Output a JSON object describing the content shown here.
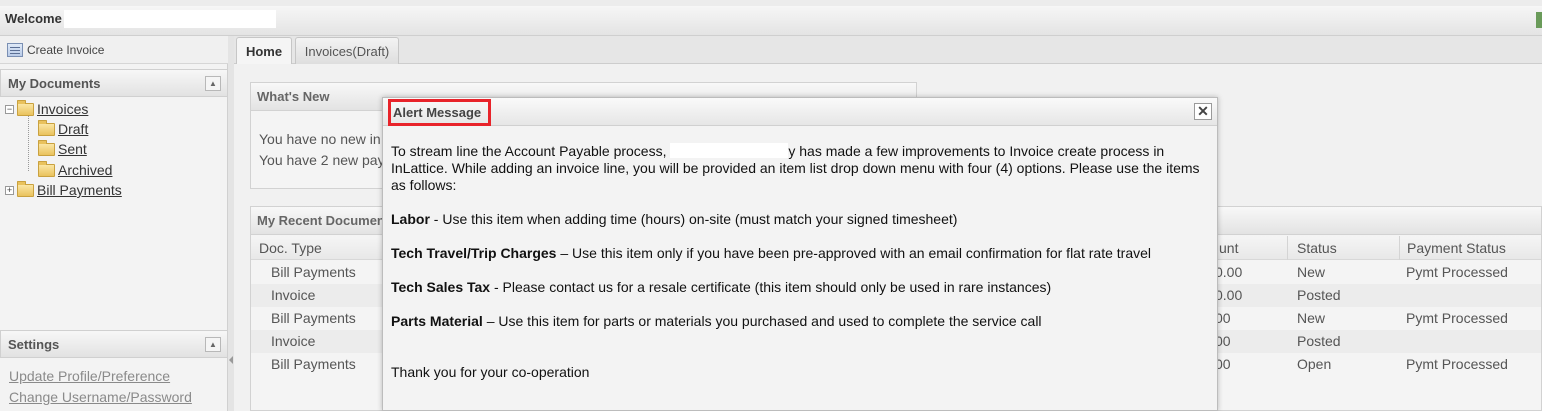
{
  "header": {
    "welcome": "Welcome"
  },
  "left_panel": {
    "create_invoice": "Create Invoice",
    "my_documents": {
      "title": "My Documents",
      "tree": {
        "invoices": "Invoices",
        "draft": "Draft",
        "sent": "Sent",
        "archived": "Archived",
        "bill_payments": "Bill Payments"
      }
    },
    "settings": {
      "title": "Settings",
      "links": [
        "Update Profile/Preference",
        "Change Username/Password"
      ]
    }
  },
  "tabs": [
    {
      "label": "Home",
      "active": true
    },
    {
      "label": "Invoices(Draft)",
      "active": false
    }
  ],
  "whats_new": {
    "title": "What's New",
    "lines": [
      "You have no new in",
      "You have 2 new pay"
    ]
  },
  "recent_docs": {
    "title": "My Recent Documen",
    "columns": [
      "Doc. Type",
      "unt",
      "Status",
      "Payment Status"
    ],
    "rows": [
      {
        "doc_type": "Bill Payments",
        "amount": "0.00",
        "status": "New",
        "payment_status": "Pymt Processed"
      },
      {
        "doc_type": "Invoice",
        "amount": "0.00",
        "status": "Posted",
        "payment_status": ""
      },
      {
        "doc_type": "Bill Payments",
        "amount": "00",
        "status": "New",
        "payment_status": "Pymt Processed"
      },
      {
        "doc_type": "Invoice",
        "amount": "00",
        "status": "Posted",
        "payment_status": ""
      },
      {
        "doc_type": "Bill Payments",
        "amount": "00",
        "status": "Open",
        "payment_status": "Pymt Processed"
      }
    ]
  },
  "alert": {
    "title": "Alert Message",
    "close": "✕",
    "intro_a": "To stream line the Account Payable process,",
    "intro_b": "y has made a few improvements to Invoice create process in",
    "intro_c": "InLattice. While adding an invoice line, you will be provided an item list drop down menu with four (4) options. Please use the items",
    "intro_d": "as follows:",
    "items": [
      {
        "name": "Labor",
        "text": " - Use this item when adding time (hours) on-site (must match your signed timesheet)"
      },
      {
        "name": "Tech Travel/Trip Charges",
        "text": " – Use this item only if you have been pre-approved with an email confirmation for flat rate travel"
      },
      {
        "name": "Tech Sales Tax",
        "text": " - Please contact us for a resale certificate (this item should only be used in rare instances)"
      },
      {
        "name": "Parts Material",
        "text": " – Use this item for parts or materials you purchased and used to complete the service call"
      }
    ],
    "closing": "Thank you for your co-operation"
  }
}
